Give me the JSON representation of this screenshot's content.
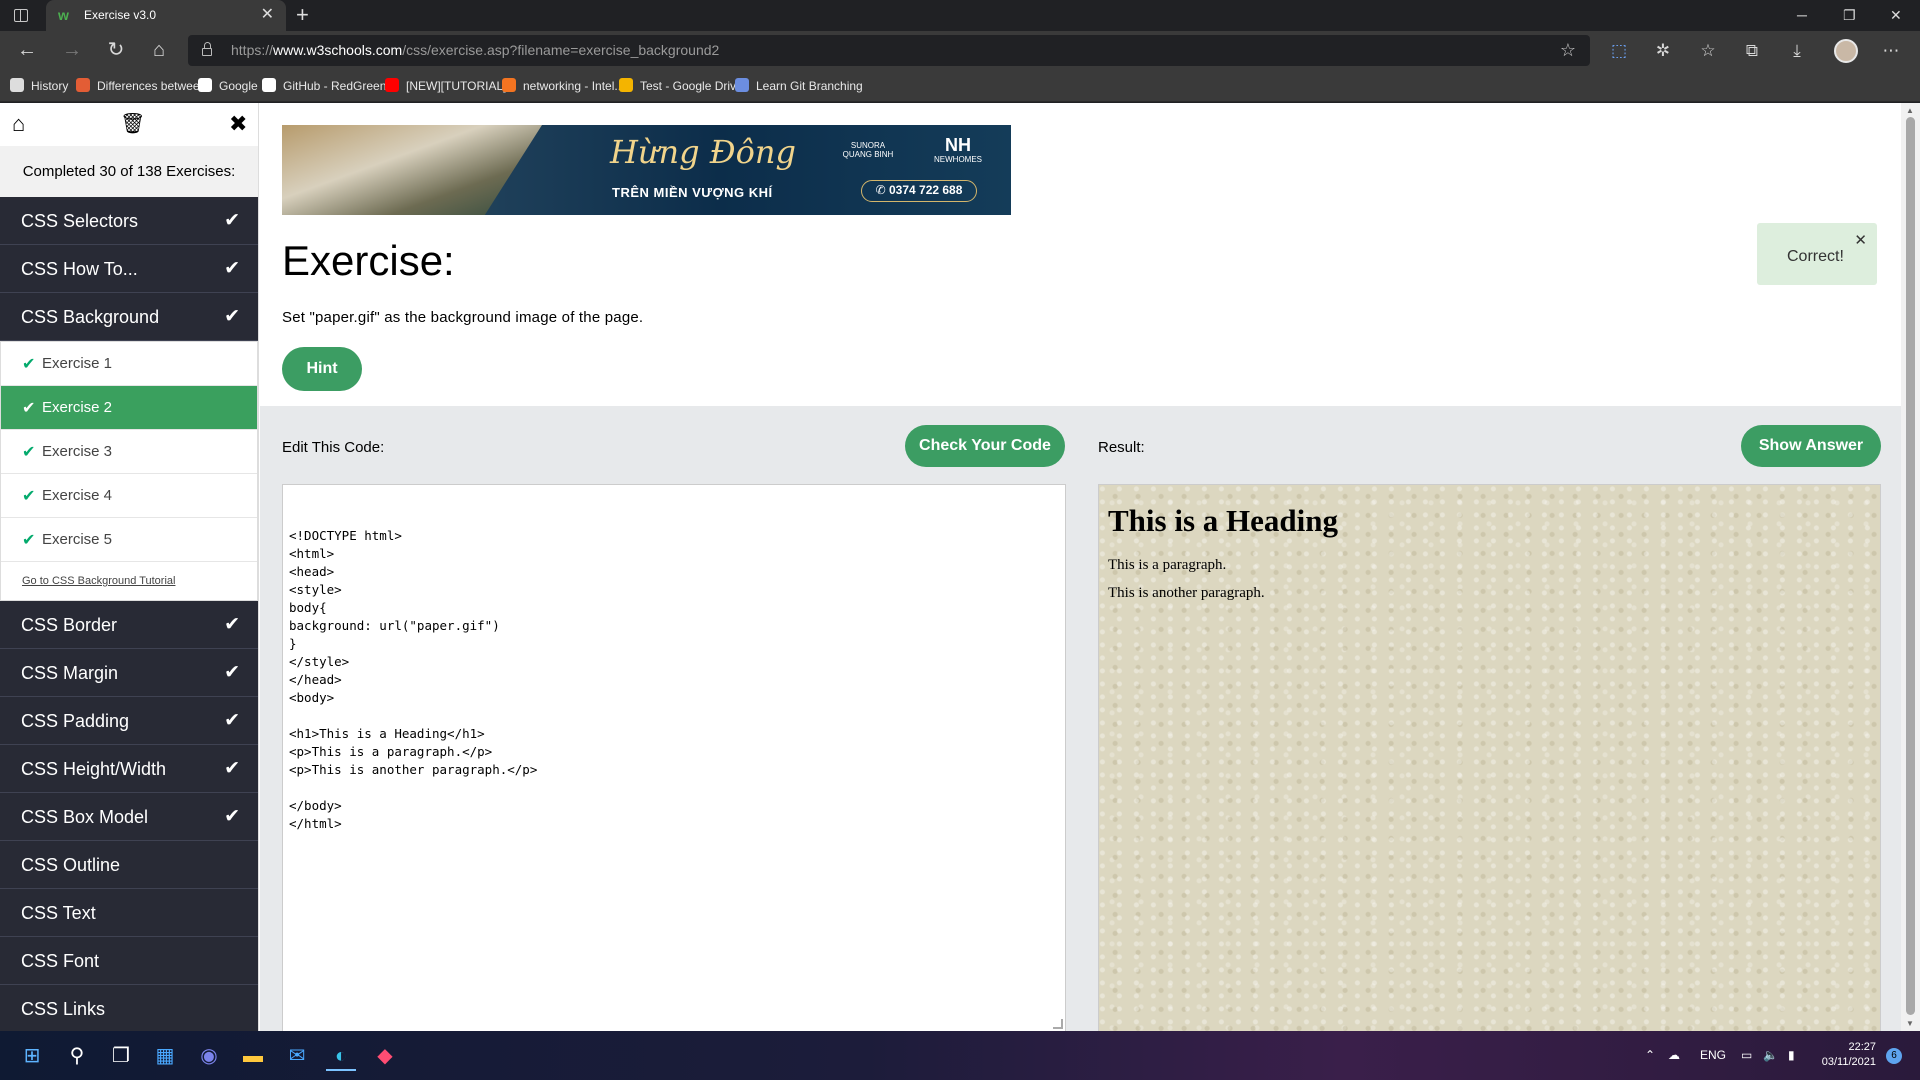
{
  "browser": {
    "tab_title": "Exercise v3.0",
    "url_prefix": "https://",
    "url_domain": "www.w3schools.com",
    "url_path": "/css/exercise.asp?filename=exercise_background2",
    "bookmarks": [
      {
        "label": "History",
        "icon": "history-icon",
        "color": "#dddddd"
      },
      {
        "label": "Differences betwee...",
        "icon": "bookmark-favicon",
        "color": "#e35d35"
      },
      {
        "label": "Google",
        "icon": "google-icon",
        "color": "#ffffff"
      },
      {
        "label": "GitHub - RedGreen...",
        "icon": "github-icon",
        "color": "#ffffff"
      },
      {
        "label": "[NEW][TUTORIAL]...",
        "icon": "youtube-icon",
        "color": "#ff0000"
      },
      {
        "label": "networking - Intel...",
        "icon": "askubuntu-icon",
        "color": "#f47421"
      },
      {
        "label": "Test - Google Drive",
        "icon": "drive-icon",
        "color": "#f4b400"
      },
      {
        "label": "Learn Git Branching",
        "icon": "git-icon",
        "color": "#6c8ee0"
      }
    ]
  },
  "sidebar": {
    "completed_text": "Completed 30 of 138 Exercises:",
    "categories_top": [
      {
        "label": "CSS Selectors",
        "done": true
      },
      {
        "label": "CSS How To...",
        "done": true
      },
      {
        "label": "CSS Background",
        "done": true
      }
    ],
    "exercises": [
      {
        "label": "Exercise 1",
        "active": false
      },
      {
        "label": "Exercise 2",
        "active": true
      },
      {
        "label": "Exercise 3",
        "active": false
      },
      {
        "label": "Exercise 4",
        "active": false
      },
      {
        "label": "Exercise 5",
        "active": false
      }
    ],
    "tutorial_link": "Go to CSS Background Tutorial",
    "categories_bottom": [
      {
        "label": "CSS Border",
        "done": true
      },
      {
        "label": "CSS Margin",
        "done": true
      },
      {
        "label": "CSS Padding",
        "done": true
      },
      {
        "label": "CSS Height/Width",
        "done": true
      },
      {
        "label": "CSS Box Model",
        "done": true
      },
      {
        "label": "CSS Outline",
        "done": false
      },
      {
        "label": "CSS Text",
        "done": false
      },
      {
        "label": "CSS Font",
        "done": false
      },
      {
        "label": "CSS Links",
        "done": false
      }
    ]
  },
  "banner": {
    "script_text": "Hừng Đông",
    "subtitle": "TRÊN MIỀN VƯỢNG KHÍ",
    "logo1": "SUNORA QUANG BINH",
    "logo2_mark": "NH",
    "logo2": "NEWHOMES",
    "phone": "0374 722 688"
  },
  "exercise": {
    "title": "Exercise:",
    "instruction": "Set \"paper.gif\" as the background image of the page.",
    "hint_label": "Hint",
    "toast": "Correct!",
    "edit_label": "Edit This Code:",
    "check_label": "Check Your Code",
    "result_label": "Result:",
    "answer_label": "Show Answer",
    "code_lines": [
      "<!DOCTYPE html>",
      "<html>",
      "<head>",
      "<style>",
      "body{",
      "background: url(\"paper.gif\")",
      "}",
      "</style>",
      "</head>",
      "<body>",
      "",
      "<h1>This is a Heading</h1>",
      "<p>This is a paragraph.</p>",
      "<p>This is another paragraph.</p>",
      "",
      "</body>",
      "</html>"
    ],
    "result_heading": "This is a Heading",
    "result_p1": "This is a paragraph.",
    "result_p2": "This is another paragraph."
  },
  "taskbar": {
    "language": "ENG",
    "time": "22:27",
    "date": "03/11/2021",
    "notifications": "6"
  },
  "colors": {
    "sidebar_dark": "#282a35",
    "accent_green": "#04aa6d"
  }
}
